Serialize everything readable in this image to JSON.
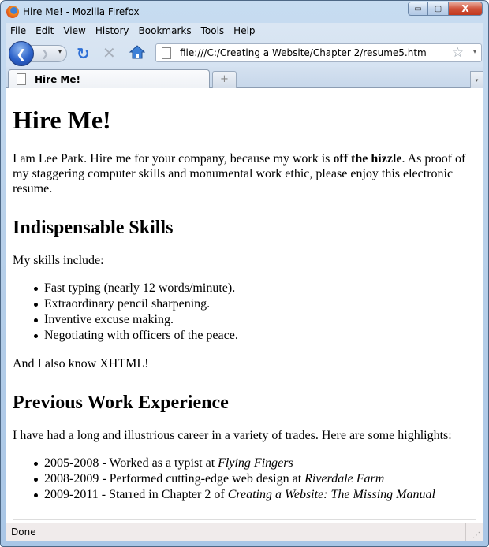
{
  "window": {
    "title": "Hire Me! - Mozilla Firefox",
    "controls": {
      "minimize": "▭",
      "maximize": "▢",
      "close": "X"
    }
  },
  "menubar": {
    "items": [
      {
        "label": "File",
        "accel": "F",
        "rest": "ile"
      },
      {
        "label": "Edit",
        "accel": "E",
        "rest": "dit"
      },
      {
        "label": "View",
        "accel": "V",
        "rest": "iew"
      },
      {
        "label": "History",
        "pre": "Hi",
        "accel": "s",
        "rest": "tory"
      },
      {
        "label": "Bookmarks",
        "accel": "B",
        "rest": "ookmarks"
      },
      {
        "label": "Tools",
        "accel": "T",
        "rest": "ools"
      },
      {
        "label": "Help",
        "accel": "H",
        "rest": "elp"
      }
    ]
  },
  "navbar": {
    "back_glyph": "❮",
    "forward_glyph": "❯",
    "dropdown_glyph": "▾",
    "reload_glyph": "↻",
    "stop_glyph": "✕",
    "url": "file:///C:/Creating a Website/Chapter 2/resume5.htm",
    "star_glyph": "☆",
    "url_dropdown_glyph": "▾"
  },
  "tabs": {
    "items": [
      {
        "label": "Hire Me!",
        "active": true
      }
    ],
    "new_tab_glyph": "+",
    "list_glyph": "▾"
  },
  "page": {
    "h1": "Hire Me!",
    "intro": {
      "before": "I am Lee Park. Hire me for your company, because my work is ",
      "bold": "off the hizzle",
      "after": ". As proof of my staggering computer skills and monumental work ethic, please enjoy this electronic resume."
    },
    "skills_heading": "Indispensable Skills",
    "skills_intro": "My skills include:",
    "skills": [
      "Fast typing (nearly 12 words/minute).",
      "Extraordinary pencil sharpening.",
      "Inventive excuse making.",
      "Negotiating with officers of the peace."
    ],
    "skills_outro": "And I also know XHTML!",
    "work_heading": "Previous Work Experience",
    "work_intro": "I have had a long and illustrious career in a variety of trades. Here are some highlights:",
    "work": [
      {
        "text": "2005-2008 - Worked as a typist at ",
        "italic": "Flying Fingers"
      },
      {
        "text": "2008-2009 - Performed cutting-edge web design at ",
        "italic": "Riverdale Farm"
      },
      {
        "text": "2009-2011 - Starred in Chapter 2 of ",
        "italic": "Creating a Website: The Missing Manual"
      }
    ]
  },
  "statusbar": {
    "text": "Done"
  }
}
